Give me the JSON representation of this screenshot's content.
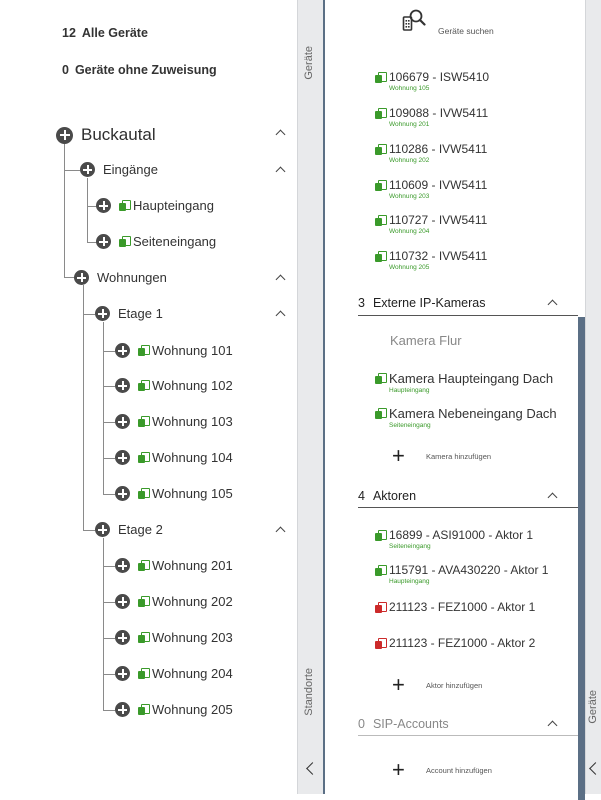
{
  "summary": {
    "all_devices_count": "12",
    "all_devices_label": "Alle Geräte",
    "unassigned_count": "0",
    "unassigned_label": "Geräte ohne Zuweisung"
  },
  "tree": {
    "root": "Buckautal",
    "entrances_label": "Eingänge",
    "entrances": [
      "Haupteingang",
      "Seiteneingang"
    ],
    "apartments_label": "Wohnungen",
    "floor1_label": "Etage 1",
    "floor1": [
      "Wohnung 101",
      "Wohnung 102",
      "Wohnung 103",
      "Wohnung 104",
      "Wohnung 105"
    ],
    "floor2_label": "Etage 2",
    "floor2": [
      "Wohnung 201",
      "Wohnung 202",
      "Wohnung 203",
      "Wohnung 204",
      "Wohnung 205"
    ]
  },
  "sidebar": {
    "tab_devices": "Geräte",
    "tab_locations": "Standorte",
    "tab_devices_right": "Geräte"
  },
  "devices_panel": {
    "search_label": "Geräte suchen",
    "top_devices": [
      {
        "name": "106679 - ISW5410",
        "sub": "Wohnung 105"
      },
      {
        "name": "109088 - IVW5411",
        "sub": "Wohnung 201"
      },
      {
        "name": "110286 - IVW5411",
        "sub": "Wohnung 202"
      },
      {
        "name": "110609 - IVW5411",
        "sub": "Wohnung 203"
      },
      {
        "name": "110727 - IVW5411",
        "sub": "Wohnung 204"
      },
      {
        "name": "110732 - IVW5411",
        "sub": "Wohnung 205"
      }
    ],
    "cameras": {
      "count": "3",
      "title": "Externe IP-Kameras",
      "unassigned": "Kamera Flur",
      "items": [
        {
          "name": "Kamera Haupteingang Dach",
          "sub": "Haupteingang"
        },
        {
          "name": "Kamera Nebeneingang Dach",
          "sub": "Seiteneingang"
        }
      ],
      "add_label": "Kamera hinzufügen"
    },
    "actors": {
      "count": "4",
      "title": "Aktoren",
      "items": [
        {
          "name": "16899 - ASI91000 - Aktor 1",
          "sub": "Seiteneingang",
          "status": "ok"
        },
        {
          "name": "115791 - AVA430220 - Aktor 1",
          "sub": "Haupteingang",
          "status": "ok"
        },
        {
          "name": "211123 - FEZ1000 - Aktor 1",
          "sub": "",
          "status": "error"
        },
        {
          "name": "211123 - FEZ1000 - Aktor 2",
          "sub": "",
          "status": "error"
        }
      ],
      "add_label": "Aktor hinzufügen"
    },
    "sip": {
      "count": "0",
      "title": "SIP-Accounts",
      "add_label": "Account hinzufügen"
    }
  },
  "colors": {
    "ok": "#3a9a2a",
    "error": "#cc2a2a",
    "accent": "#5b6f85"
  }
}
